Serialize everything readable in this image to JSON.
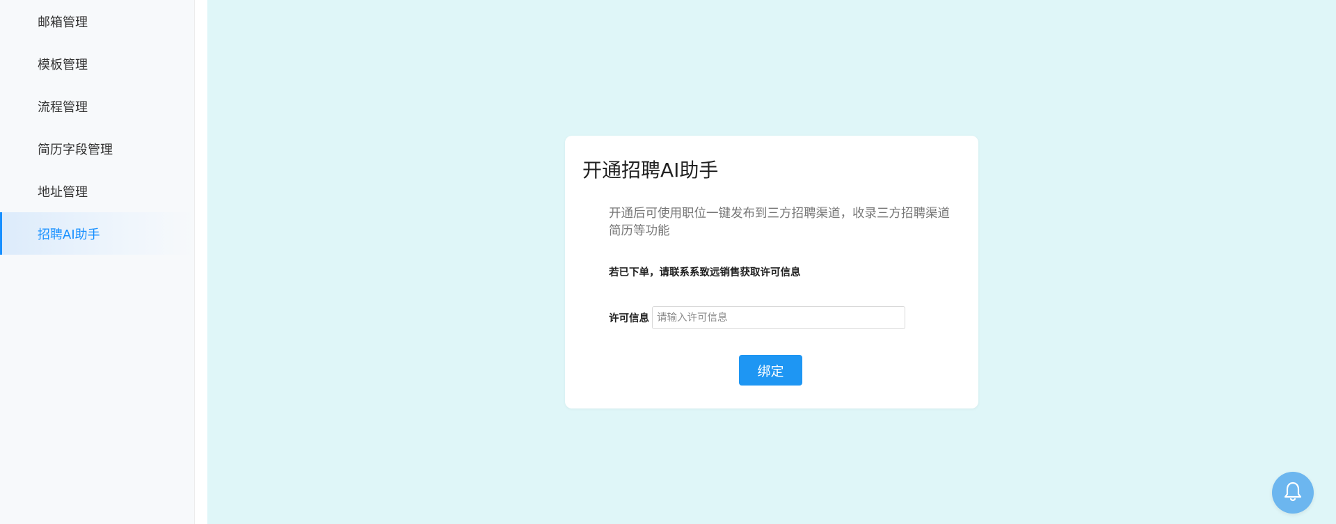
{
  "sidebar": {
    "items": [
      {
        "label": "邮箱管理",
        "active": false
      },
      {
        "label": "模板管理",
        "active": false
      },
      {
        "label": "流程管理",
        "active": false
      },
      {
        "label": "简历字段管理",
        "active": false
      },
      {
        "label": "地址管理",
        "active": false
      },
      {
        "label": "招聘AI助手",
        "active": true
      }
    ]
  },
  "card": {
    "title": "开通招聘AI助手",
    "description": "开通后可使用职位一键发布到三方招聘渠道，收录三方招聘渠道简历等功能",
    "note": "若已下单，请联系系致远销售获取许可信息",
    "license_label": "许可信息",
    "license_value": "",
    "license_placeholder": "请输入许可信息",
    "bind_label": "绑定"
  },
  "icons": {
    "bell": "bell-icon"
  },
  "colors": {
    "accent": "#1890ff",
    "button": "#1e96f3",
    "main_bg": "#dff6f8",
    "bell_bg": "#6cb6ef"
  }
}
